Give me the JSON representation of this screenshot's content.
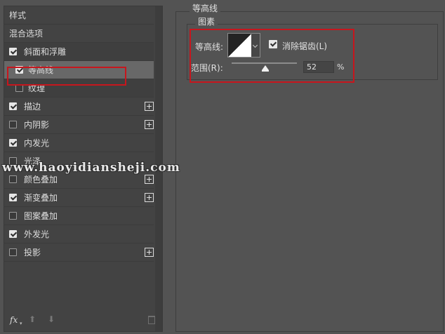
{
  "styles_list": {
    "header": "样式",
    "blend_options": "混合选项",
    "items": [
      {
        "label": "斜面和浮雕",
        "checked": true,
        "plus": false
      },
      {
        "label": "等高线",
        "checked": true,
        "plus": false,
        "selected": true,
        "sub": true
      },
      {
        "label": "纹理",
        "checked": false,
        "plus": false,
        "sub": true
      },
      {
        "label": "描边",
        "checked": true,
        "plus": true
      },
      {
        "label": "内阴影",
        "checked": false,
        "plus": true
      },
      {
        "label": "内发光",
        "checked": true,
        "plus": false
      },
      {
        "label": "光泽",
        "checked": false,
        "plus": false
      },
      {
        "label": "颜色叠加",
        "checked": false,
        "plus": true
      },
      {
        "label": "渐变叠加",
        "checked": true,
        "plus": true
      },
      {
        "label": "图案叠加",
        "checked": false,
        "plus": false
      },
      {
        "label": "外发光",
        "checked": true,
        "plus": false
      },
      {
        "label": "投影",
        "checked": false,
        "plus": true
      }
    ]
  },
  "bottom_bar": {
    "fx": "fx",
    "caret": "▾",
    "up": "⬆",
    "down": "⬇"
  },
  "contour_panel": {
    "group_title": "等高线",
    "sub_title": "图素",
    "contour_label": "等高线:",
    "anti_alias_label": "消除锯齿(L)",
    "anti_alias_checked": true,
    "range_label": "范围(R):",
    "range_value": "52",
    "range_unit": "%"
  },
  "watermark": "www.haoyidiansheji.com",
  "colors": {
    "highlight_box": "#c7161d",
    "selected_row": "#686868",
    "panel_bg": "#535353"
  }
}
